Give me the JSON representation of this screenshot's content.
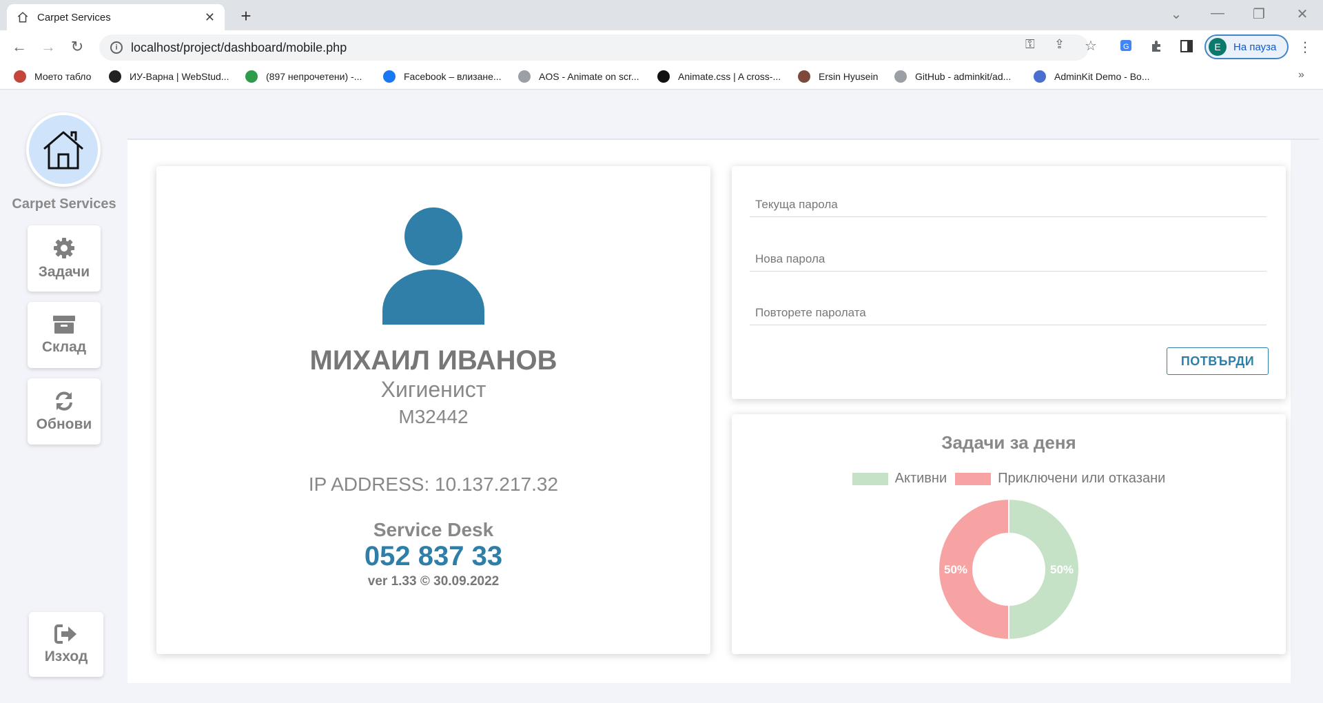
{
  "browser": {
    "tab_title": "Carpet Services",
    "url": "localhost/project/dashboard/mobile.php",
    "profile_initial": "E",
    "profile_label": "На пауза",
    "bookmarks": [
      {
        "label": "Моето табло",
        "color": "#c4463a"
      },
      {
        "label": "ИУ-Варна | WebStud...",
        "color": "#222222"
      },
      {
        "label": "(897 непрочетени) -...",
        "color": "#2e9c4a"
      },
      {
        "label": "Facebook – влизане...",
        "color": "#1877f2"
      },
      {
        "label": "AOS - Animate on scr...",
        "color": "#9aa0a6"
      },
      {
        "label": "Animate.css | A cross-...",
        "color": "#111111"
      },
      {
        "label": "Ersin Hyusein",
        "color": "#7b4a3a"
      },
      {
        "label": "GitHub - adminkit/ad...",
        "color": "#9aa0a6"
      },
      {
        "label": "AdminKit Demo - Bo...",
        "color": "#4a6fd1"
      }
    ]
  },
  "sidebar": {
    "brand": "Carpet Services",
    "items": [
      {
        "label": "Задачи",
        "icon": "gear-icon"
      },
      {
        "label": "Склад",
        "icon": "archive-icon"
      },
      {
        "label": "Обнови",
        "icon": "refresh-icon"
      }
    ],
    "logout_label": "Изход"
  },
  "profile": {
    "name": "МИХАИЛ ИВАНОВ",
    "role": "Хигиенист",
    "id": "М32442",
    "ip": "IP ADDRESS: 10.137.217.32",
    "service_desk_title": "Service Desk",
    "service_desk_phone": "052 837 33",
    "version": "ver 1.33 © 30.09.2022"
  },
  "password_form": {
    "current_placeholder": "Текуща парола",
    "new_placeholder": "Нова парола",
    "repeat_placeholder": "Повторете паролата",
    "confirm_label": "ПОТВЪРДИ"
  },
  "colors": {
    "accent": "#2e7fa8",
    "avatar": "#2f7fa8",
    "active": "#c6e2c6",
    "closed": "#f7a3a3"
  },
  "chart_data": {
    "type": "pie",
    "title": "Задачи за деня",
    "categories": [
      "Активни",
      "Приключени или отказани"
    ],
    "values": [
      50,
      50
    ],
    "value_labels": [
      "50%",
      "50%"
    ],
    "colors": [
      "#c6e2c6",
      "#f7a3a3"
    ],
    "legend": "top",
    "hole": true
  }
}
